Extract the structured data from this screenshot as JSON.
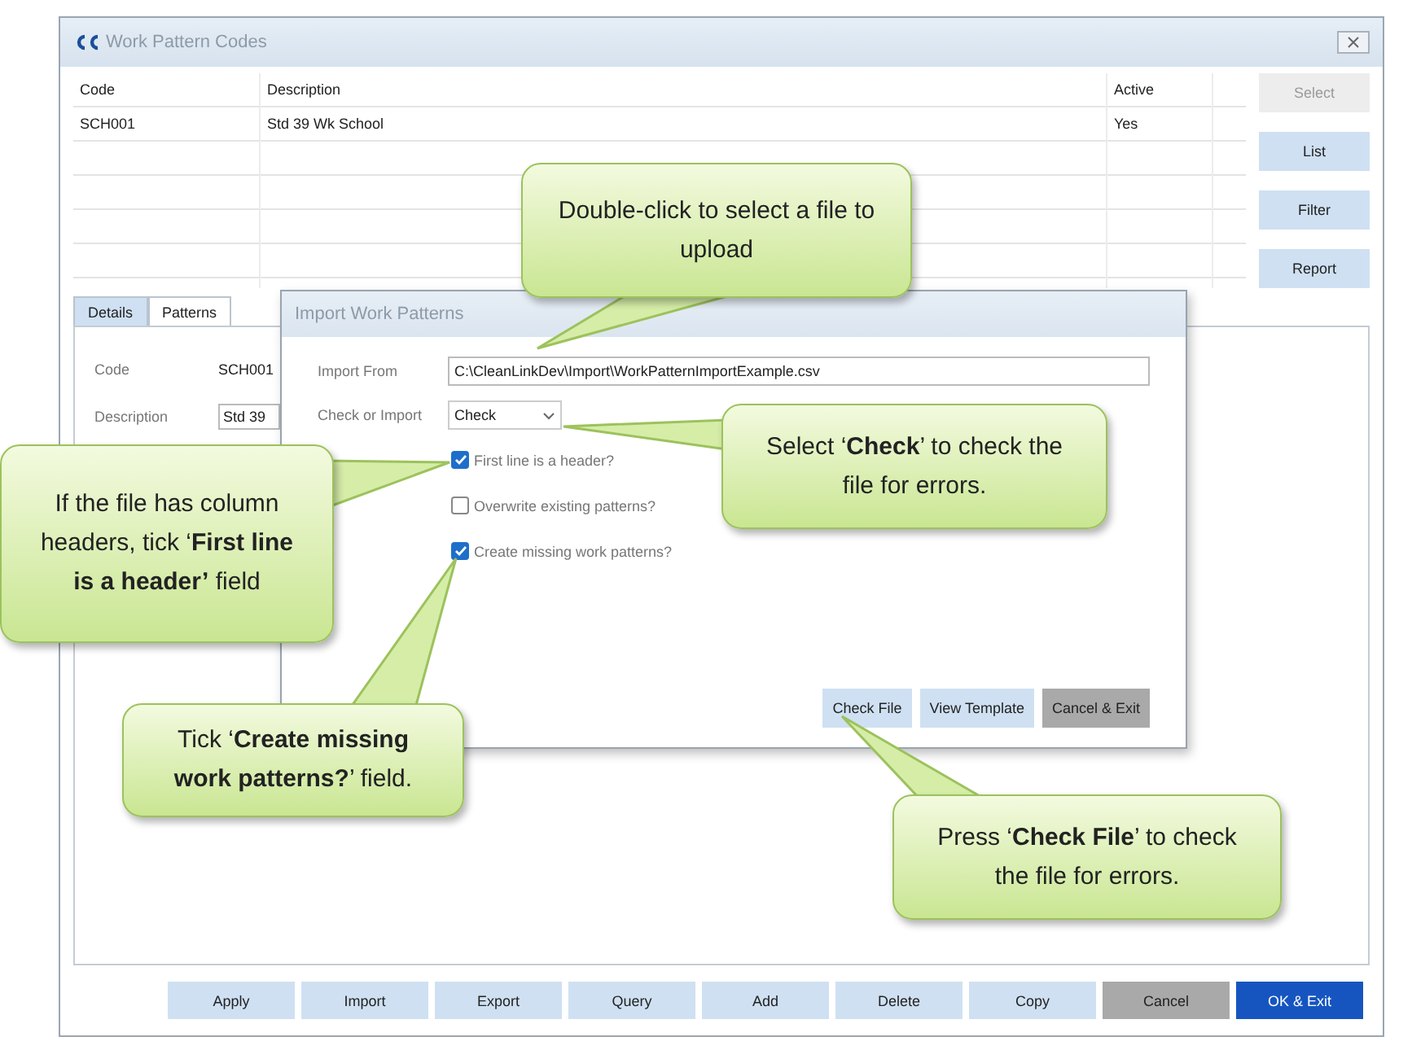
{
  "window": {
    "title": "Work Pattern Codes"
  },
  "table": {
    "columns": [
      "Code",
      "Description",
      "Active"
    ],
    "rows": [
      {
        "code": "SCH001",
        "description": "Std 39 Wk School",
        "active": "Yes"
      }
    ]
  },
  "side_buttons": [
    {
      "label": "Select",
      "disabled": true
    },
    {
      "label": "List",
      "disabled": false
    },
    {
      "label": "Filter",
      "disabled": false
    },
    {
      "label": "Report",
      "disabled": false
    }
  ],
  "tabs": [
    {
      "label": "Details",
      "selected": true
    },
    {
      "label": "Patterns",
      "selected": false
    }
  ],
  "details": [
    {
      "label": "Code",
      "value": "SCH001",
      "kind": "text"
    },
    {
      "label": "Description",
      "value": "Std 39",
      "kind": "input"
    }
  ],
  "dialog": {
    "title": "Import Work Patterns",
    "import_from": {
      "label": "Import From",
      "value": "C:\\CleanLinkDev\\Import\\WorkPatternImportExample.csv"
    },
    "check_or_import": {
      "label": "Check or Import",
      "value": "Check"
    },
    "checkboxes": [
      {
        "label": "First line is a header?",
        "checked": true
      },
      {
        "label": "Overwrite existing patterns?",
        "checked": false
      },
      {
        "label": "Create missing work patterns?",
        "checked": true
      }
    ],
    "buttons": [
      {
        "label": "Check File",
        "kind": "normal"
      },
      {
        "label": "View Template",
        "kind": "normal"
      },
      {
        "label": "Cancel & Exit",
        "kind": "cancel"
      }
    ]
  },
  "bottom_buttons": [
    {
      "label": "Apply",
      "kind": "normal"
    },
    {
      "label": "Import",
      "kind": "normal"
    },
    {
      "label": "Export",
      "kind": "normal"
    },
    {
      "label": "Query",
      "kind": "normal"
    },
    {
      "label": "Add",
      "kind": "normal"
    },
    {
      "label": "Delete",
      "kind": "normal"
    },
    {
      "label": "Copy",
      "kind": "normal"
    },
    {
      "label": "Cancel",
      "kind": "cancel"
    },
    {
      "label": "OK & Exit",
      "kind": "primary"
    }
  ],
  "callouts": [
    {
      "text": "Double-click to select a file to upload"
    },
    {
      "text": "If the file has column headers, tick ‘**First line is a header’** field"
    },
    {
      "text": "Select ‘**Check**’ to check the file for errors."
    },
    {
      "text": "Tick ‘**Create missing work patterns?**’ field."
    },
    {
      "text": "Press ‘**Check File**’ to check the file for errors."
    }
  ]
}
